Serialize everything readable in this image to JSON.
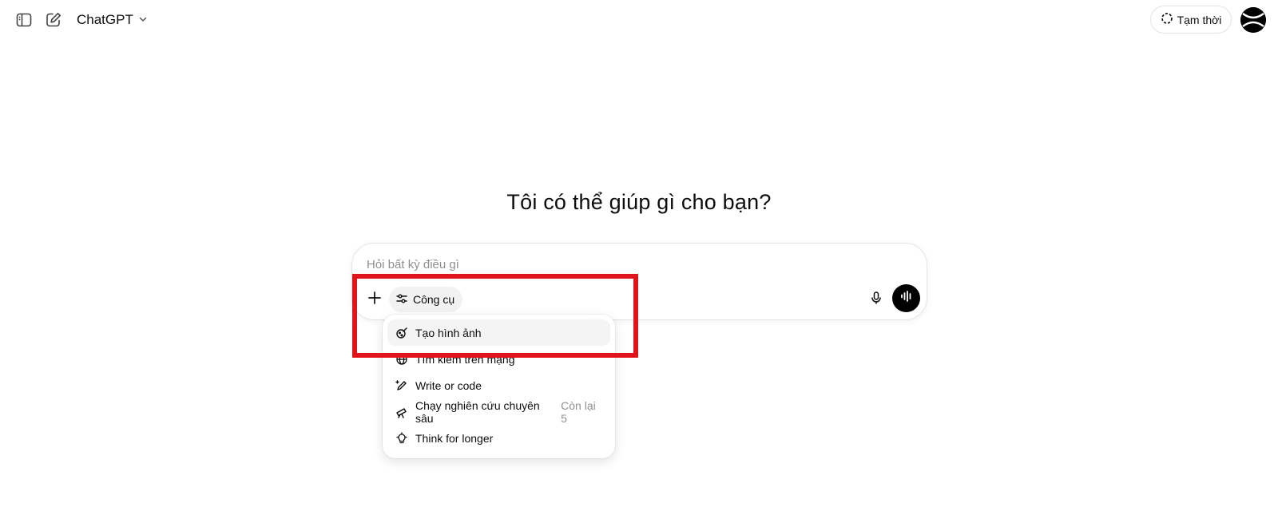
{
  "header": {
    "model_name": "ChatGPT",
    "temporary_label": "Tạm thời",
    "sidebar_toggle_icon": "sidebar-icon",
    "new_chat_icon": "compose-icon"
  },
  "hero": {
    "title": "Tôi có thể giúp gì cho bạn?"
  },
  "composer": {
    "placeholder": "Hỏi bất kỳ điều gì",
    "value": "",
    "tools_label": "Công cụ"
  },
  "tools_menu": {
    "items": [
      {
        "label": "Tạo hình ảnh",
        "icon": "image-create-icon",
        "meta": ""
      },
      {
        "label": "Tìm kiếm trên mạng",
        "icon": "globe-icon",
        "meta": ""
      },
      {
        "label": "Write or code",
        "icon": "pen-icon",
        "meta": ""
      },
      {
        "label": "Chạy nghiên cứu chuyên sâu",
        "icon": "telescope-icon",
        "meta": "Còn lại 5"
      },
      {
        "label": "Think for longer",
        "icon": "lightbulb-icon",
        "meta": ""
      }
    ]
  },
  "colors": {
    "accent_black": "#000000",
    "highlight_red": "#e1141b",
    "placeholder_gray": "#8f8f8f"
  }
}
